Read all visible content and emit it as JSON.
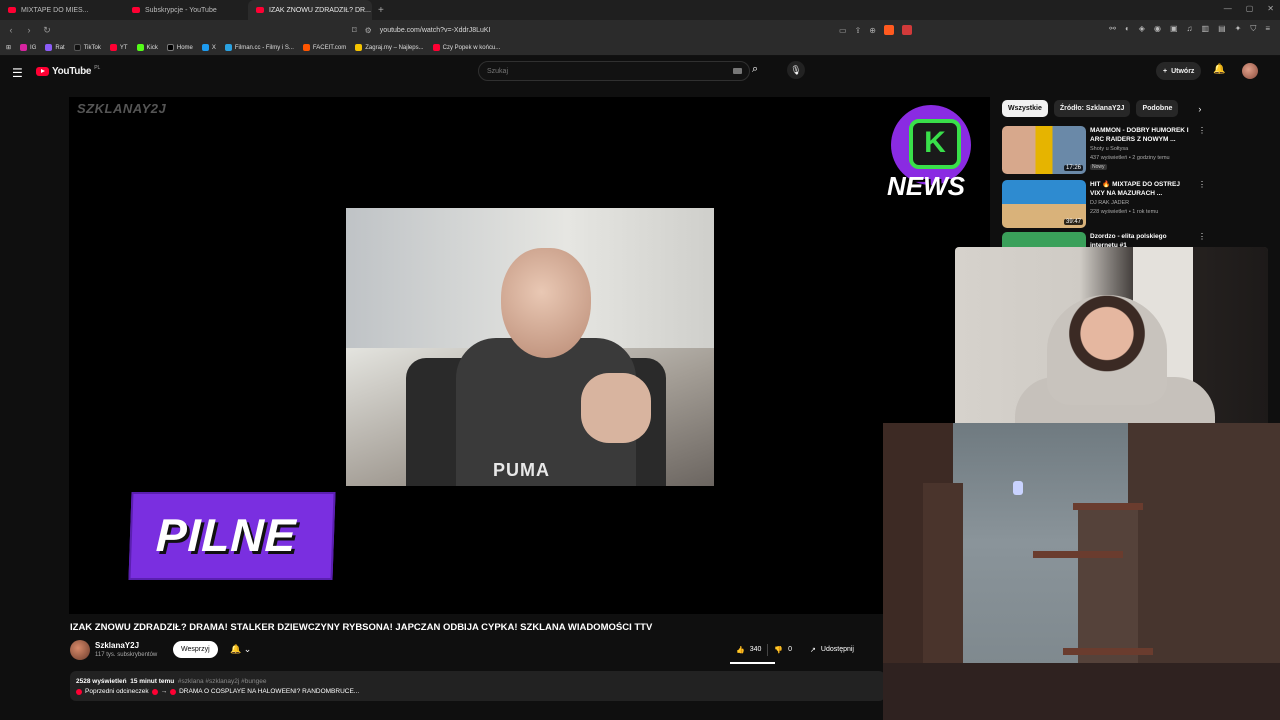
{
  "browser": {
    "tabs": [
      {
        "label": "MIXTAPE DO MIES...",
        "active": false
      },
      {
        "label": "Subskrypcje - YouTube",
        "active": false
      },
      {
        "label": "IZAK ZNOWU ZDRADZIŁ? DR...",
        "active": true
      }
    ],
    "url": "youtube.com/watch?v=-XddrJ8LuKI",
    "bookmarks": [
      "IG",
      "Rat",
      "TikTok",
      "YT",
      "Kick",
      "Home",
      "X",
      "Filman.cc - Filmy i S...",
      "FACEIT.com",
      "Zagraj.my – Najleps...",
      "Czy Popek w końcu..."
    ]
  },
  "header": {
    "logo": "YouTube",
    "country": "PL",
    "search_placeholder": "Szukaj",
    "create_label": "Utwórz"
  },
  "video": {
    "watermark": "SZKLANAY2J",
    "news_logo_text": "NEWS",
    "news_logo_letter": "K",
    "clip_text": "PUMA",
    "overlay_text": "PILNE",
    "title": "IZAK ZNOWU ZDRADZIŁ? DRAMA! STALKER DZIEWCZYNY RYBSONA! JAPCZAN ODBIJA CYPKA! SZKLANA WIADOMOŚCI TTV"
  },
  "channel": {
    "name": "SzklanaY2J",
    "subs": "117 tys. subskrybentów",
    "support_label": "Wesprzyj"
  },
  "actions": {
    "likes": "340",
    "dislikes": "0",
    "share_label": "Udostępnij"
  },
  "description": {
    "views": "2528 wyświetleń",
    "time": "15 minut temu",
    "tags": "#szklana #szklanay2j #bungee",
    "prev_label": "Poprzedni odcineczek",
    "prev_text": "DRAMA O COSPLAYE NA HALOWEENI? RANDOMBRUCE..."
  },
  "sidebar": {
    "chips": [
      "Wszystkie",
      "Źródło: SzklanaY2J",
      "Podobne"
    ],
    "recommendations": [
      {
        "title": "MAMMON - DOBRY HUMOREK I ARC RAIDERS Z NOWYM ...",
        "channel": "Shoty u Sołtysa",
        "views": "437 wyświetleń • 2 godziny temu",
        "badge": "Nowy",
        "duration": "17:26",
        "color": "#8a6a50"
      },
      {
        "title": "HIT 🔥 MIXTAPE DO OSTREJ VIXY NA MAZURACH ...",
        "channel": "DJ RAK JADER",
        "views": "228 wyświetleń • 1 rok temu",
        "badge": "",
        "duration": "39:47",
        "color": "#2e8bd0"
      },
      {
        "title": "Dzordzo - elita polskiego internetu #1",
        "channel": "",
        "views": "",
        "badge": "",
        "duration": "",
        "color": "#3aa05a"
      }
    ]
  },
  "colors": {
    "accent": "#ff0033",
    "pilne_bg": "#7a2fe0",
    "news_purple": "#8a2be2",
    "news_green": "#39e04a"
  }
}
